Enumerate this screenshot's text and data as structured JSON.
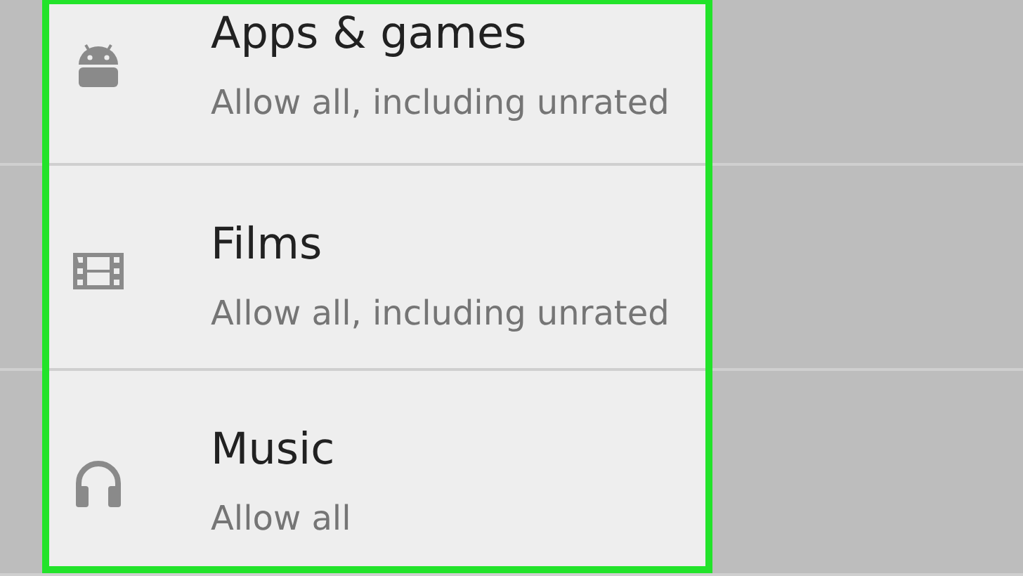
{
  "settings_list": [
    {
      "title": "Apps & games",
      "subtitle": "Allow all, including unrated"
    },
    {
      "title": "Films",
      "subtitle": "Allow all, including unrated"
    },
    {
      "title": "Music",
      "subtitle": "Allow all"
    }
  ]
}
